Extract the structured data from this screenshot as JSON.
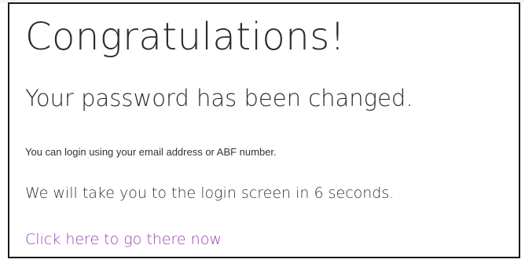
{
  "confirmation": {
    "heading": "Congratulations!",
    "subheading": "Your password has been changed.",
    "login_note": "You can login using your email address or ABF number.",
    "redirect_note": "We will take you to the login screen in 6 seconds.",
    "redirect_seconds": 6,
    "link_label": "Click here to go there now"
  },
  "colors": {
    "text": "#2b2b2b",
    "link": "#9b3fb5",
    "border": "#1a1a1a"
  }
}
